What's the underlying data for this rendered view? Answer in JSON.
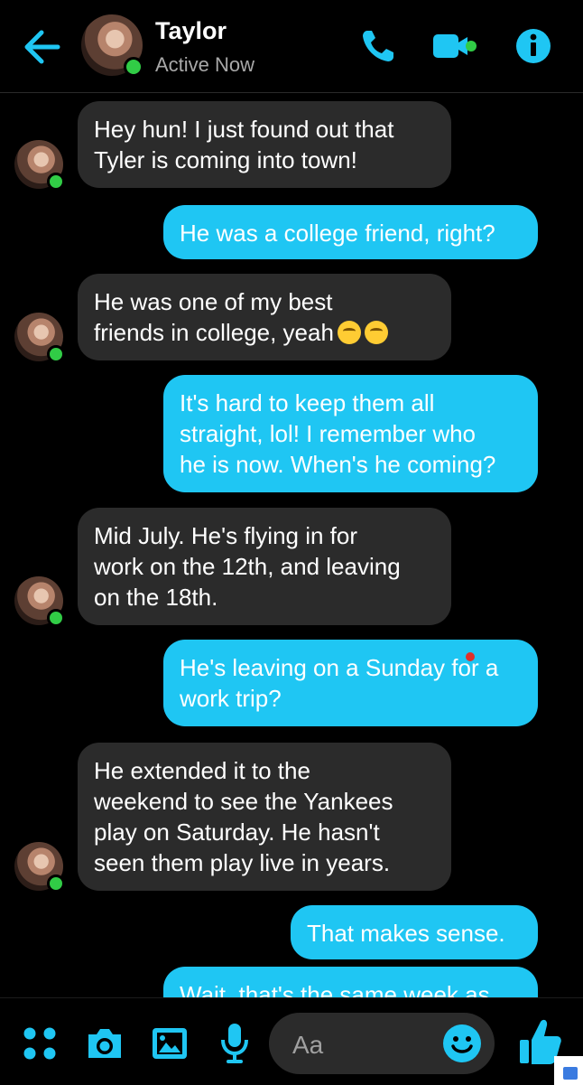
{
  "header": {
    "contact_name": "Taylor",
    "status": "Active Now",
    "accent_color": "#1fc6f3",
    "online_color": "#31cc46",
    "icons": [
      "back-arrow-icon",
      "phone-icon",
      "video-camera-icon",
      "info-icon"
    ]
  },
  "messages": [
    {
      "side": "incoming",
      "lines": [
        "Hey hun! I just found out that",
        "Tyler is coming into town!"
      ]
    },
    {
      "side": "outgoing",
      "lines": [
        "He was a college friend, right?"
      ]
    },
    {
      "side": "incoming",
      "lines": [
        "He was one of my best",
        "friends in college, yeah"
      ],
      "emojis": [
        "eye-roll-emoji",
        "kiss-emoji"
      ]
    },
    {
      "side": "outgoing",
      "lines": [
        "It's hard to keep them all",
        "straight, lol! I remember who",
        "he is now. When's he coming?"
      ]
    },
    {
      "side": "incoming",
      "lines": [
        "Mid July. He's flying in for",
        "work on the 12th, and leaving",
        "on the 18th."
      ]
    },
    {
      "side": "outgoing",
      "lines": [
        "He's leaving on a Sunday for a",
        "work trip?"
      ]
    },
    {
      "side": "incoming",
      "lines": [
        "He extended it to the",
        "weekend to see the Yankees",
        "play on Saturday. He hasn't",
        "seen them play live in years."
      ]
    },
    {
      "side": "outgoing",
      "lines": [
        "That makes sense."
      ]
    },
    {
      "side": "outgoing",
      "lines": [
        "Wait, that's the same week as"
      ]
    }
  ],
  "composer": {
    "placeholder": "Aa",
    "icons": [
      "apps-grid-icon",
      "camera-icon",
      "gallery-icon",
      "microphone-icon",
      "emoji-icon",
      "thumbs-up-icon"
    ]
  }
}
